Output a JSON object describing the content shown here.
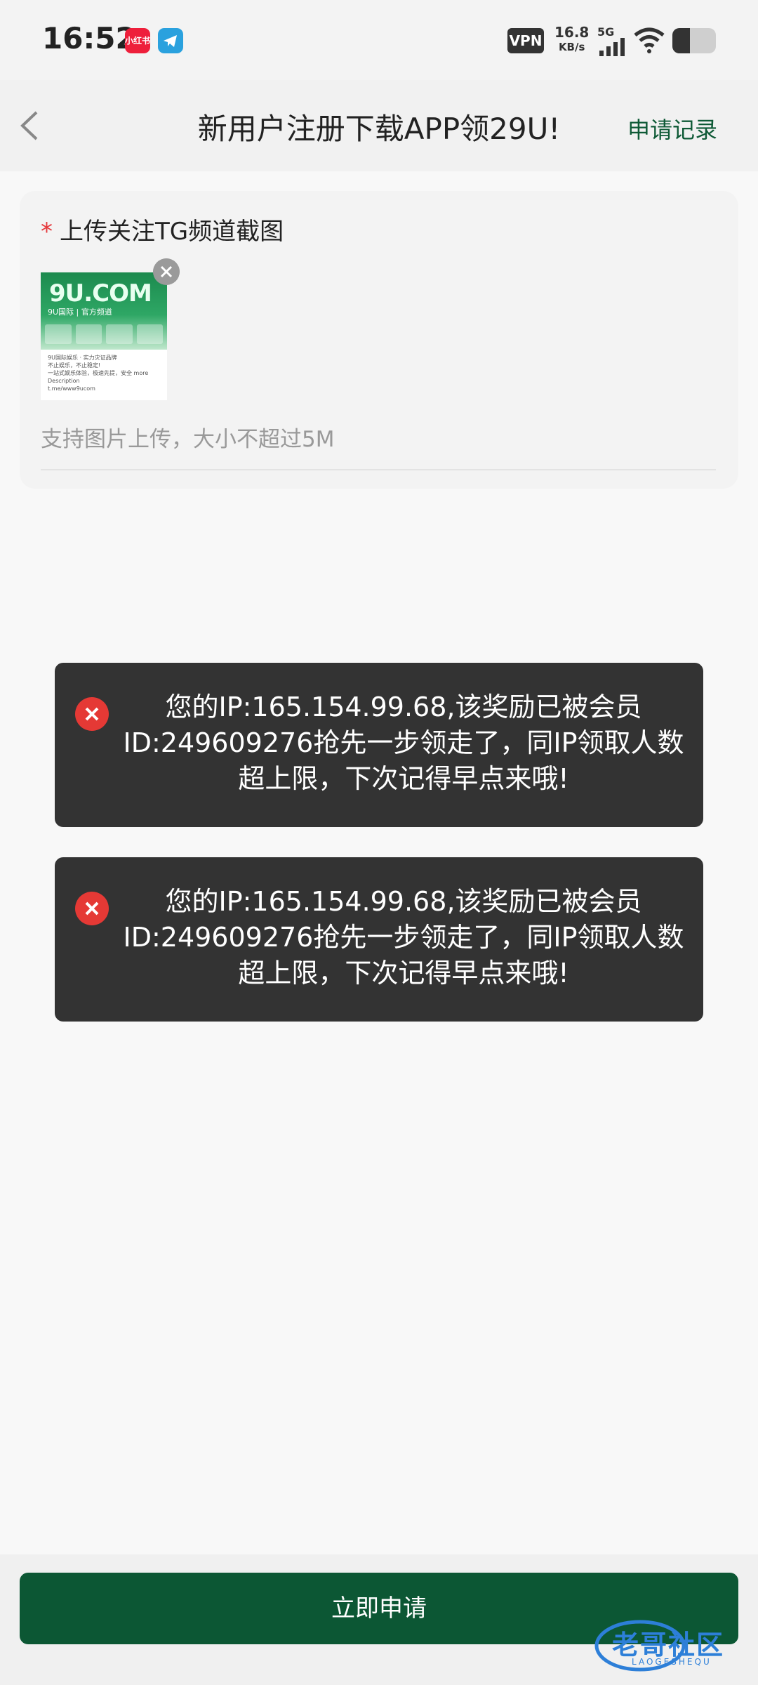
{
  "status_bar": {
    "time": "16:52",
    "red_app_label": "小红书",
    "vpn": "VPN",
    "speed_value": "16.8",
    "speed_unit": "KB/s",
    "network": "5G",
    "battery_level": 0.4
  },
  "header": {
    "title": "新用户注册下载APP领29U!",
    "records_label": "申请记录"
  },
  "upload": {
    "required_mark": "*",
    "label": "上传关注TG频道截图",
    "hint": "支持图片上传，大小不超过5M",
    "thumbnail": {
      "logo_text": "9U.COM",
      "subtitle": "9U国际 | 官方频道",
      "line1": "9U国际娱乐 · 实力灾证品牌",
      "line2": "不止娱乐，不止稳定!",
      "line3": "一站式娱乐体验，极速先提，安全 more",
      "line4": "Description",
      "link": "t.me/www9ucom"
    }
  },
  "toasts": [
    {
      "message": "您的IP:165.154.99.68,该奖励已被会员ID:249609276抢先一步领走了，同IP领取人数超上限，下次记得早点来哦!"
    },
    {
      "message": "您的IP:165.154.99.68,该奖励已被会员ID:249609276抢先一步领走了，同IP领取人数超上限，下次记得早点来哦!"
    }
  ],
  "footer": {
    "apply_label": "立即申请"
  },
  "watermark": {
    "main": "老哥社区",
    "sub": "LAOGESHEQU"
  },
  "colors": {
    "accent": "#0c5734",
    "records_link": "#0e5a36",
    "required": "#e5383b",
    "error_icon": "#e53935",
    "toast_bg": "#333333"
  }
}
